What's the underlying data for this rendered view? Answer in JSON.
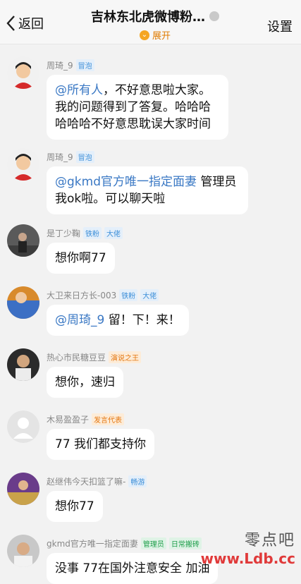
{
  "header": {
    "back_label": "返回",
    "title": "吉林东北虎微博粉…",
    "expand_label": "展开",
    "settings_label": "设置"
  },
  "messages": [
    {
      "name": "周琦_9",
      "badges": [
        "冒泡"
      ],
      "mention": "@所有人",
      "text": "，不好意思啦大家。我的问题得到了答复。哈哈哈哈哈哈不好意思耽误大家时间"
    },
    {
      "name": "周琦_9",
      "badges": [
        "冒泡"
      ],
      "mention": "@gkmd官方唯一指定面妻",
      "text": " 管理员我ok啦。可以聊天啦"
    },
    {
      "name": "是丁少鞠",
      "badges": [
        "铁粉",
        "大佬"
      ],
      "mention": "",
      "text": "想你啊77"
    },
    {
      "name": "大卫来日方长-003",
      "badges": [
        "铁粉",
        "大佬"
      ],
      "mention": "@周琦_9",
      "text": " 留！下！来！"
    },
    {
      "name": "热心市民糖豆豆",
      "badges": [
        "演说之王"
      ],
      "mention": "",
      "text": "想你，速归"
    },
    {
      "name": "木易盈盈子",
      "badges": [
        "发言代表"
      ],
      "mention": "",
      "text": "77 我们都支持你"
    },
    {
      "name": "赵继伟今天扣篮了嘛-",
      "badges": [
        "畅游"
      ],
      "mention": "",
      "text": "想你77"
    },
    {
      "name": "gkmd官方唯一指定面妻",
      "badges": [
        "管理员",
        "日常搬砖"
      ],
      "mention": "",
      "text": "没事 77在国外注意安全 加油"
    }
  ],
  "watermark": {
    "line1": "零点吧",
    "line2": "www.Ldb.cc"
  }
}
